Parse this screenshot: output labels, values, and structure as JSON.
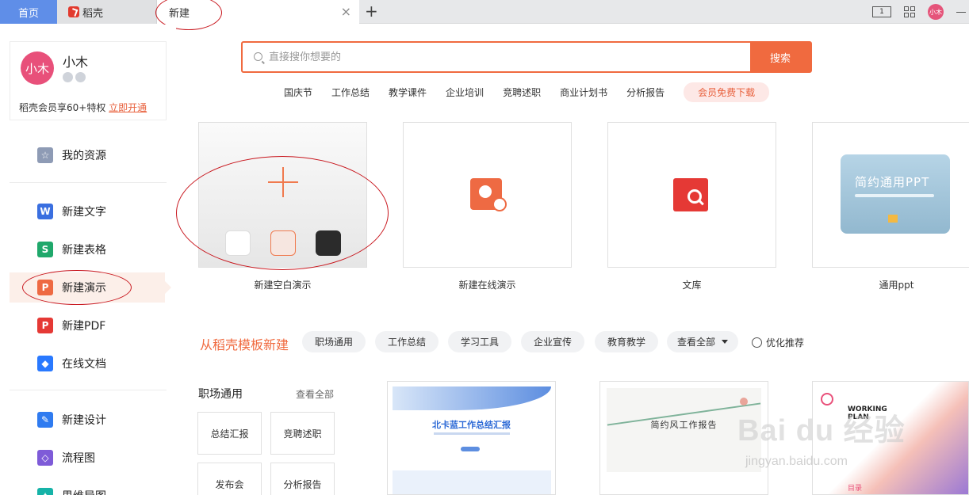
{
  "tabs": {
    "home": "首页",
    "daoke": "稻壳",
    "new": "新建",
    "close": "×",
    "add": "+"
  },
  "toolbar": {
    "layout_glyph": "1",
    "avatar": "小木"
  },
  "colors": {
    "accent": "#f06a3f",
    "home_tab": "#5f8ee8",
    "avatar": "#e8507a"
  },
  "profile": {
    "avatar_text": "小木",
    "name": "小木",
    "vip_text": "稻壳会员享60+特权",
    "vip_link": "立即开通"
  },
  "sidebar": {
    "items": [
      {
        "label": "我的资源",
        "icon": "star-icon",
        "color": "#8e9bb5",
        "glyph": "☆"
      },
      {
        "label": "新建文字",
        "icon": "writer-icon",
        "color": "#3a6fe0",
        "glyph": "W"
      },
      {
        "label": "新建表格",
        "icon": "spreadsheet-icon",
        "color": "#1fa86b",
        "glyph": "S"
      },
      {
        "label": "新建演示",
        "icon": "presentation-icon",
        "color": "#ee6a43",
        "glyph": "P"
      },
      {
        "label": "新建PDF",
        "icon": "pdf-icon",
        "color": "#e53935",
        "glyph": "P"
      },
      {
        "label": "在线文档",
        "icon": "cloud-doc-icon",
        "color": "#2979ff",
        "glyph": "◆"
      },
      {
        "label": "新建设计",
        "icon": "design-icon",
        "color": "#2f7bf0",
        "glyph": "✎"
      },
      {
        "label": "流程图",
        "icon": "flowchart-icon",
        "color": "#7e5bd8",
        "glyph": "◇"
      },
      {
        "label": "思维导图",
        "icon": "mindmap-icon",
        "color": "#16b3a8",
        "glyph": "✦"
      }
    ]
  },
  "search": {
    "placeholder": "直接搜你想要的",
    "button": "搜索"
  },
  "hotwords": [
    "国庆节",
    "工作总结",
    "教学课件",
    "企业培训",
    "竞聘述职",
    "商业计划书",
    "分析报告"
  ],
  "free_download": "会员免费下载",
  "cards": [
    {
      "label": "新建空白演示"
    },
    {
      "label": "新建在线演示"
    },
    {
      "label": "文库"
    },
    {
      "label": "通用ppt",
      "thumb_title": "简约通用PPT"
    }
  ],
  "templates": {
    "title": "从稻壳模板新建",
    "chips": [
      "职场通用",
      "工作总结",
      "学习工具",
      "企业宣传",
      "教育教学",
      "查看全部"
    ],
    "recommend": "优化推荐"
  },
  "category": {
    "title": "职场通用",
    "view_all": "查看全部",
    "buttons": [
      "总结汇报",
      "竞聘述职",
      "发布会",
      "分析报告"
    ]
  },
  "thumbs": [
    {
      "title": "北卡蓝工作总结汇报"
    },
    {
      "title": "简约风工作报告"
    },
    {
      "title": "WORKING PLAN",
      "menu": "目录"
    }
  ],
  "watermark": {
    "main": "Bai du 经验",
    "sub": "jingyan.baidu.com"
  }
}
